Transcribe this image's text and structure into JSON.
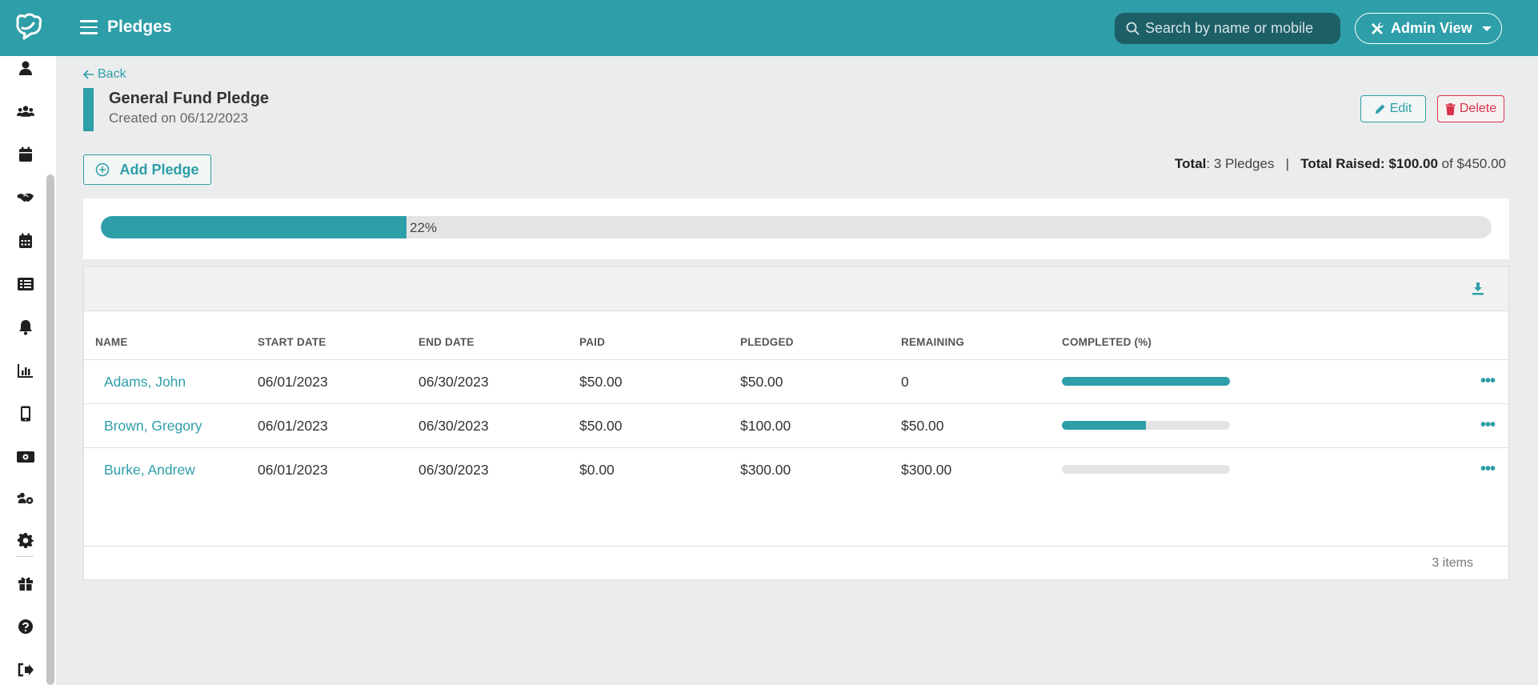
{
  "header": {
    "title": "Pledges",
    "search_placeholder": "Search by name or mobile",
    "admin_label": "Admin View"
  },
  "sidebar": {
    "icons": [
      "person-icon",
      "group-icon",
      "calendar-icon",
      "handshake-icon",
      "calendar-grid-icon",
      "list-icon",
      "bell-icon",
      "bar-chart-icon",
      "mobile-icon",
      "money-icon",
      "users-cog-icon",
      "gear-icon",
      "gift-icon",
      "help-icon",
      "sign-out-icon"
    ]
  },
  "page": {
    "back_label": "Back",
    "pledge_title": "General Fund Pledge",
    "created_label": "Created on 06/12/2023",
    "edit_label": "Edit",
    "delete_label": "Delete",
    "add_pledge_label": "Add Pledge",
    "totals": {
      "total_label": "Total",
      "total_value": ": 3 Pledges",
      "separator": "|",
      "raised_label": "Total Raised:",
      "raised_value": "$100.00",
      "of_text": "of $450.00"
    },
    "progress": {
      "percent": 22,
      "label": "22%"
    }
  },
  "table": {
    "columns": [
      "NAME",
      "START DATE",
      "END DATE",
      "PAID",
      "PLEDGED",
      "REMAINING",
      "COMPLETED (%)"
    ],
    "rows": [
      {
        "name": "Adams, John",
        "start": "06/01/2023",
        "end": "06/30/2023",
        "paid": "$50.00",
        "pledged": "$50.00",
        "remaining": "0",
        "completed": 100
      },
      {
        "name": "Brown, Gregory",
        "start": "06/01/2023",
        "end": "06/30/2023",
        "paid": "$50.00",
        "pledged": "$100.00",
        "remaining": "$50.00",
        "completed": 50
      },
      {
        "name": "Burke, Andrew",
        "start": "06/01/2023",
        "end": "06/30/2023",
        "paid": "$0.00",
        "pledged": "$300.00",
        "remaining": "$300.00",
        "completed": 0
      }
    ],
    "items_count": "3 items"
  },
  "colors": {
    "brand": "#2e9ea8",
    "danger": "#d9334a"
  }
}
